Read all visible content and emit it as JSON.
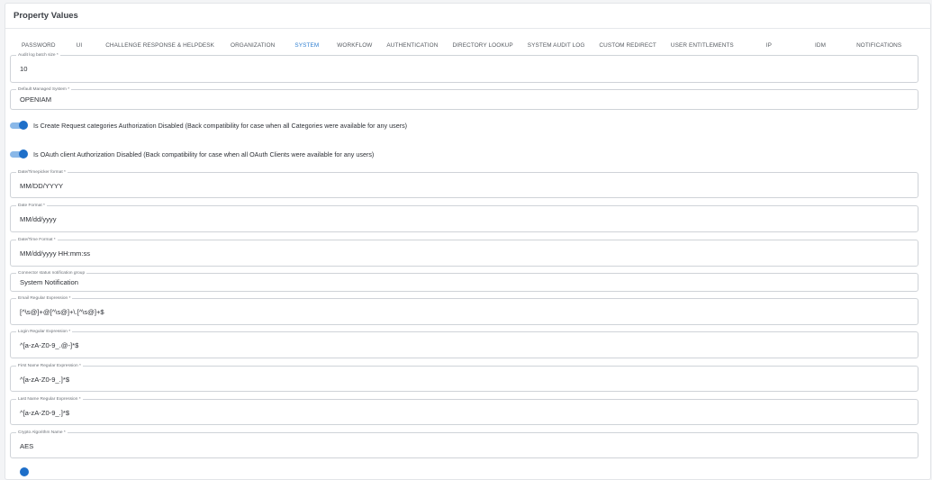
{
  "page": {
    "title": "Property Values"
  },
  "tabs": [
    {
      "label": "PASSWORD"
    },
    {
      "label": "UI"
    },
    {
      "label": "CHALLENGE RESPONSE & HELPDESK"
    },
    {
      "label": "ORGANIZATION"
    },
    {
      "label": "SYSTEM",
      "active": true
    },
    {
      "label": "WORKFLOW"
    },
    {
      "label": "AUTHENTICATION"
    },
    {
      "label": "DIRECTORY LOOKUP"
    },
    {
      "label": "SYSTEM AUDIT LOG"
    },
    {
      "label": "CUSTOM REDIRECT"
    },
    {
      "label": "USER ENTITLEMENTS"
    },
    {
      "label": "IP"
    },
    {
      "label": "IDM"
    },
    {
      "label": "NOTIFICATIONS"
    }
  ],
  "fields": {
    "audit_batch": {
      "label": "Audit log batch size *",
      "value": "10"
    },
    "managed_system": {
      "label": "Default Managed System *",
      "value": "OPENIAM"
    },
    "datepicker_format": {
      "label": "Date/Timepicker format *",
      "value": "MM/DD/YYYY"
    },
    "date_format": {
      "label": "Date Format *",
      "value": "MM/dd/yyyy"
    },
    "datetime_format": {
      "label": "Date/Time Format *",
      "value": "MM/dd/yyyy HH:mm:ss"
    },
    "connector_group": {
      "label": "Connector status notification group",
      "value": "System Notification"
    },
    "email_regex": {
      "label": "Email Regular Expression *",
      "value": "[^\\s@]+@[^\\s@]+\\.[^\\s@]+$"
    },
    "login_regex": {
      "label": "Login Regular Expression *",
      "value": "^[a-zA-Z0-9_.@-]*$"
    },
    "firstname_regex": {
      "label": "First Name Regular Expression *",
      "value": "^[a-zA-Z0-9_.]*$"
    },
    "lastname_regex": {
      "label": "Last Name Regular Expression *",
      "value": "^[a-zA-Z0-9_.]*$"
    },
    "crypto_algorithm": {
      "label": "Crypto Algorithm Name *",
      "value": "AES"
    }
  },
  "toggles": {
    "request_categories": {
      "label": "Is Create Request categories Authorization Disabled (Back compatibility for case when all Categories were available for any users)",
      "on": true
    },
    "oauth_client": {
      "label": "Is OAuth client Authorization Disabled (Back compatibility for case when all OAuth Clients were available for any users)",
      "on": true
    }
  },
  "colors": {
    "accent": "#2f7fd1",
    "toggle_on": "#1e6fc9"
  }
}
